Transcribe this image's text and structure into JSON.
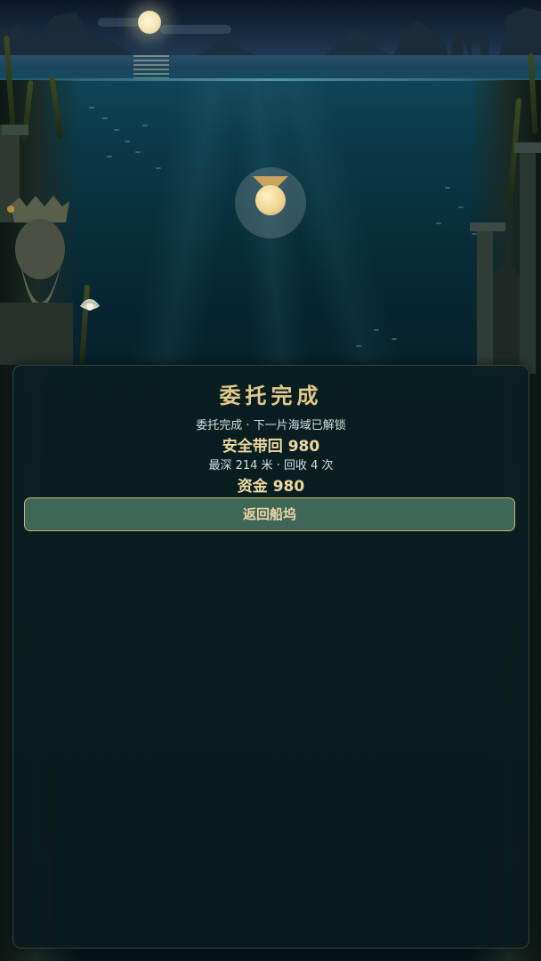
{
  "result": {
    "title": "委托完成",
    "subtitle": "委托完成 · 下一片海域已解锁",
    "safe_return": "安全带回 980",
    "stats": "最深 214 米 · 回收 4 次",
    "funds": "资金 980"
  },
  "actions": {
    "return_label": "返回船坞"
  },
  "icons": {
    "medal": "medal-icon",
    "pearl": "pearl-shell-icon",
    "moon": "moon"
  },
  "colors": {
    "accent_gold": "#e3c98b",
    "button_fill": "#3f6757",
    "panel_bg": "#0b1f22"
  }
}
